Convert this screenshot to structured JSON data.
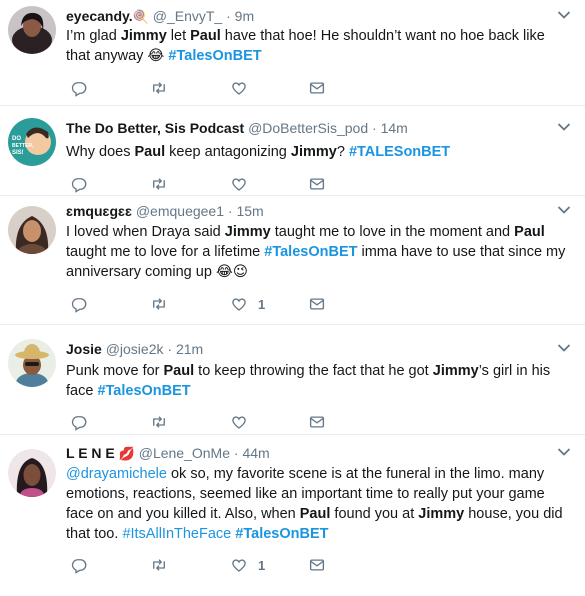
{
  "tweets": [
    {
      "name": "eyecandy.",
      "name_emoji": "🍭",
      "handle": "@_EnvyT_",
      "time": "9m",
      "text_parts": [
        "I’m glad ",
        "Jimmy",
        " let ",
        "Paul",
        " have that hoe! He shouldn’t want no hoe back like that anyway ",
        "😂",
        " ",
        "#TalesOnBET"
      ],
      "like_count": ""
    },
    {
      "name": "The Do Better, Sis Podcast",
      "name_emoji": "",
      "handle": "@DoBetterSis_pod",
      "time": "14m",
      "text_parts": [
        "Why does ",
        "Paul",
        " keep antagonizing ",
        "Jimmy",
        "? ",
        "#TALESonBET"
      ],
      "like_count": "",
      "avatar_text": "DO BETTER, SIS!"
    },
    {
      "name": "ɛmquɛgɛɛ",
      "name_emoji": "",
      "handle": "@emquegee1",
      "time": "15m",
      "text_parts": [
        "I loved when Draya said ",
        "Jimmy",
        " taught me to love in the moment and ",
        "Paul",
        " taught me to love for a lifetime ",
        "#TalesOnBET",
        " imma have to use that since my anniversary coming up ",
        "😂😉"
      ],
      "like_count": "1"
    },
    {
      "name": "Josie",
      "name_emoji": "",
      "handle": "@josie2k",
      "time": "21m",
      "text_parts": [
        "Punk move for ",
        "Paul",
        " to keep throwing the fact that he got ",
        "Jimmy",
        "’s girl in his face ",
        "#TalesOnBET"
      ],
      "like_count": ""
    },
    {
      "name": "L E N E",
      "name_emoji": "💋",
      "handle": "@Lene_OnMe",
      "time": "44m",
      "text_parts": [
        "@drayamichele",
        " ok so, my favorite scene is at the funeral in the limo. many emotions, reactions, seemed like an important time to really put your game face on and you killed it. Also, when ",
        "Paul",
        " found you at ",
        "Jimmy",
        " house, you did that too. ",
        "#ItsAllInTheFace",
        " ",
        "#TalesOnBET"
      ],
      "like_count": "1"
    }
  ],
  "separator": "·"
}
